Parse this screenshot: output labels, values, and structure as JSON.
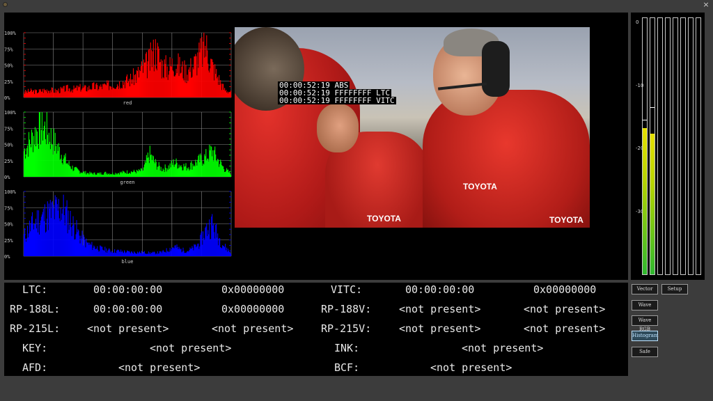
{
  "window": {
    "close_glyph": "×",
    "app_icon": "app-icon"
  },
  "histograms": [
    {
      "name": "red",
      "label": "red",
      "color": "#ff0000",
      "seed": 3,
      "ylabels": [
        "100%",
        "75%",
        "50%",
        "25%",
        "0%"
      ],
      "profile": [
        0.08,
        0.1,
        0.09,
        0.11,
        0.12,
        0.1,
        0.12,
        0.14,
        0.13,
        0.15,
        0.14,
        0.17,
        0.16,
        0.18,
        0.2,
        0.22,
        0.25,
        0.28,
        0.35,
        0.45,
        0.55,
        0.75,
        0.5,
        0.45,
        0.55,
        0.45,
        0.4,
        0.5,
        0.65,
        0.8,
        0.5,
        0.3,
        0.12,
        0.08
      ]
    },
    {
      "name": "green",
      "label": "green",
      "color": "#00ff00",
      "seed": 7,
      "ylabels": [
        "100%",
        "75%",
        "50%",
        "25%",
        "0%"
      ],
      "profile": [
        0.4,
        0.55,
        0.7,
        0.78,
        0.65,
        0.5,
        0.35,
        0.2,
        0.12,
        0.08,
        0.06,
        0.05,
        0.05,
        0.06,
        0.05,
        0.06,
        0.07,
        0.08,
        0.08,
        0.1,
        0.35,
        0.2,
        0.12,
        0.15,
        0.22,
        0.18,
        0.15,
        0.2,
        0.25,
        0.3,
        0.4,
        0.25,
        0.12,
        0.05
      ]
    },
    {
      "name": "blue",
      "label": "blue",
      "color": "#0000ff",
      "seed": 11,
      "ylabels": [
        "100%",
        "75%",
        "50%",
        "25%",
        "0%"
      ],
      "profile": [
        0.3,
        0.45,
        0.55,
        0.6,
        0.65,
        0.7,
        0.75,
        0.6,
        0.45,
        0.3,
        0.2,
        0.15,
        0.12,
        0.1,
        0.08,
        0.08,
        0.07,
        0.06,
        0.06,
        0.06,
        0.05,
        0.05,
        0.06,
        0.1,
        0.15,
        0.1,
        0.08,
        0.12,
        0.2,
        0.4,
        0.5,
        0.3,
        0.15,
        0.05
      ]
    }
  ],
  "video": {
    "timecodes": [
      "00:00:52:19 ABS",
      "00:00:52:19 FFFFFFFF LTC",
      "00:00:52:19 FFFFFFFF VITC"
    ],
    "logo_text": "TOYOTA"
  },
  "audio_meter": {
    "scale": [
      "0",
      "-10",
      "-20",
      "-30"
    ],
    "channels": [
      {
        "level": 0.57,
        "peak": 0.6
      },
      {
        "level": 0.55,
        "peak": 0.65
      },
      {
        "level": 0,
        "peak": 0
      },
      {
        "level": 0,
        "peak": 0
      },
      {
        "level": 0,
        "peak": 0
      },
      {
        "level": 0,
        "peak": 0
      },
      {
        "level": 0,
        "peak": 0
      },
      {
        "level": 0,
        "peak": 0
      }
    ]
  },
  "info": {
    "ltc_label": "LTC:",
    "ltc_time": "00:00:00:00",
    "ltc_hex": "0x00000000",
    "vitc_label": "VITC:",
    "vitc_time": "00:00:00:00",
    "vitc_hex": "0x00000000",
    "rp188l_label": "RP-188L:",
    "rp188l_time": "00:00:00:00",
    "rp188l_hex": "0x00000000",
    "rp188v_label": "RP-188V:",
    "rp188v_a": "<not present>",
    "rp188v_b": "<not present>",
    "rp215l_label": "RP-215L:",
    "rp215l_a": "<not present>",
    "rp215l_b": "<not present>",
    "rp215v_label": "RP-215V:",
    "rp215v_a": "<not present>",
    "rp215v_b": "<not present>",
    "key_label": "KEY:",
    "key_value": "<not present>",
    "ink_label": "INK:",
    "ink_value": "<not present>",
    "afd_label": "AFD:",
    "afd_value": "<not present>",
    "bcf_label": "BCF:",
    "bcf_value": "<not present>"
  },
  "buttons": {
    "vector": "Vector",
    "setup": "Setup",
    "wave": "Wave",
    "wave_rgb": "Wave RGB",
    "histogram": "Histogram",
    "safe": "Safe"
  }
}
